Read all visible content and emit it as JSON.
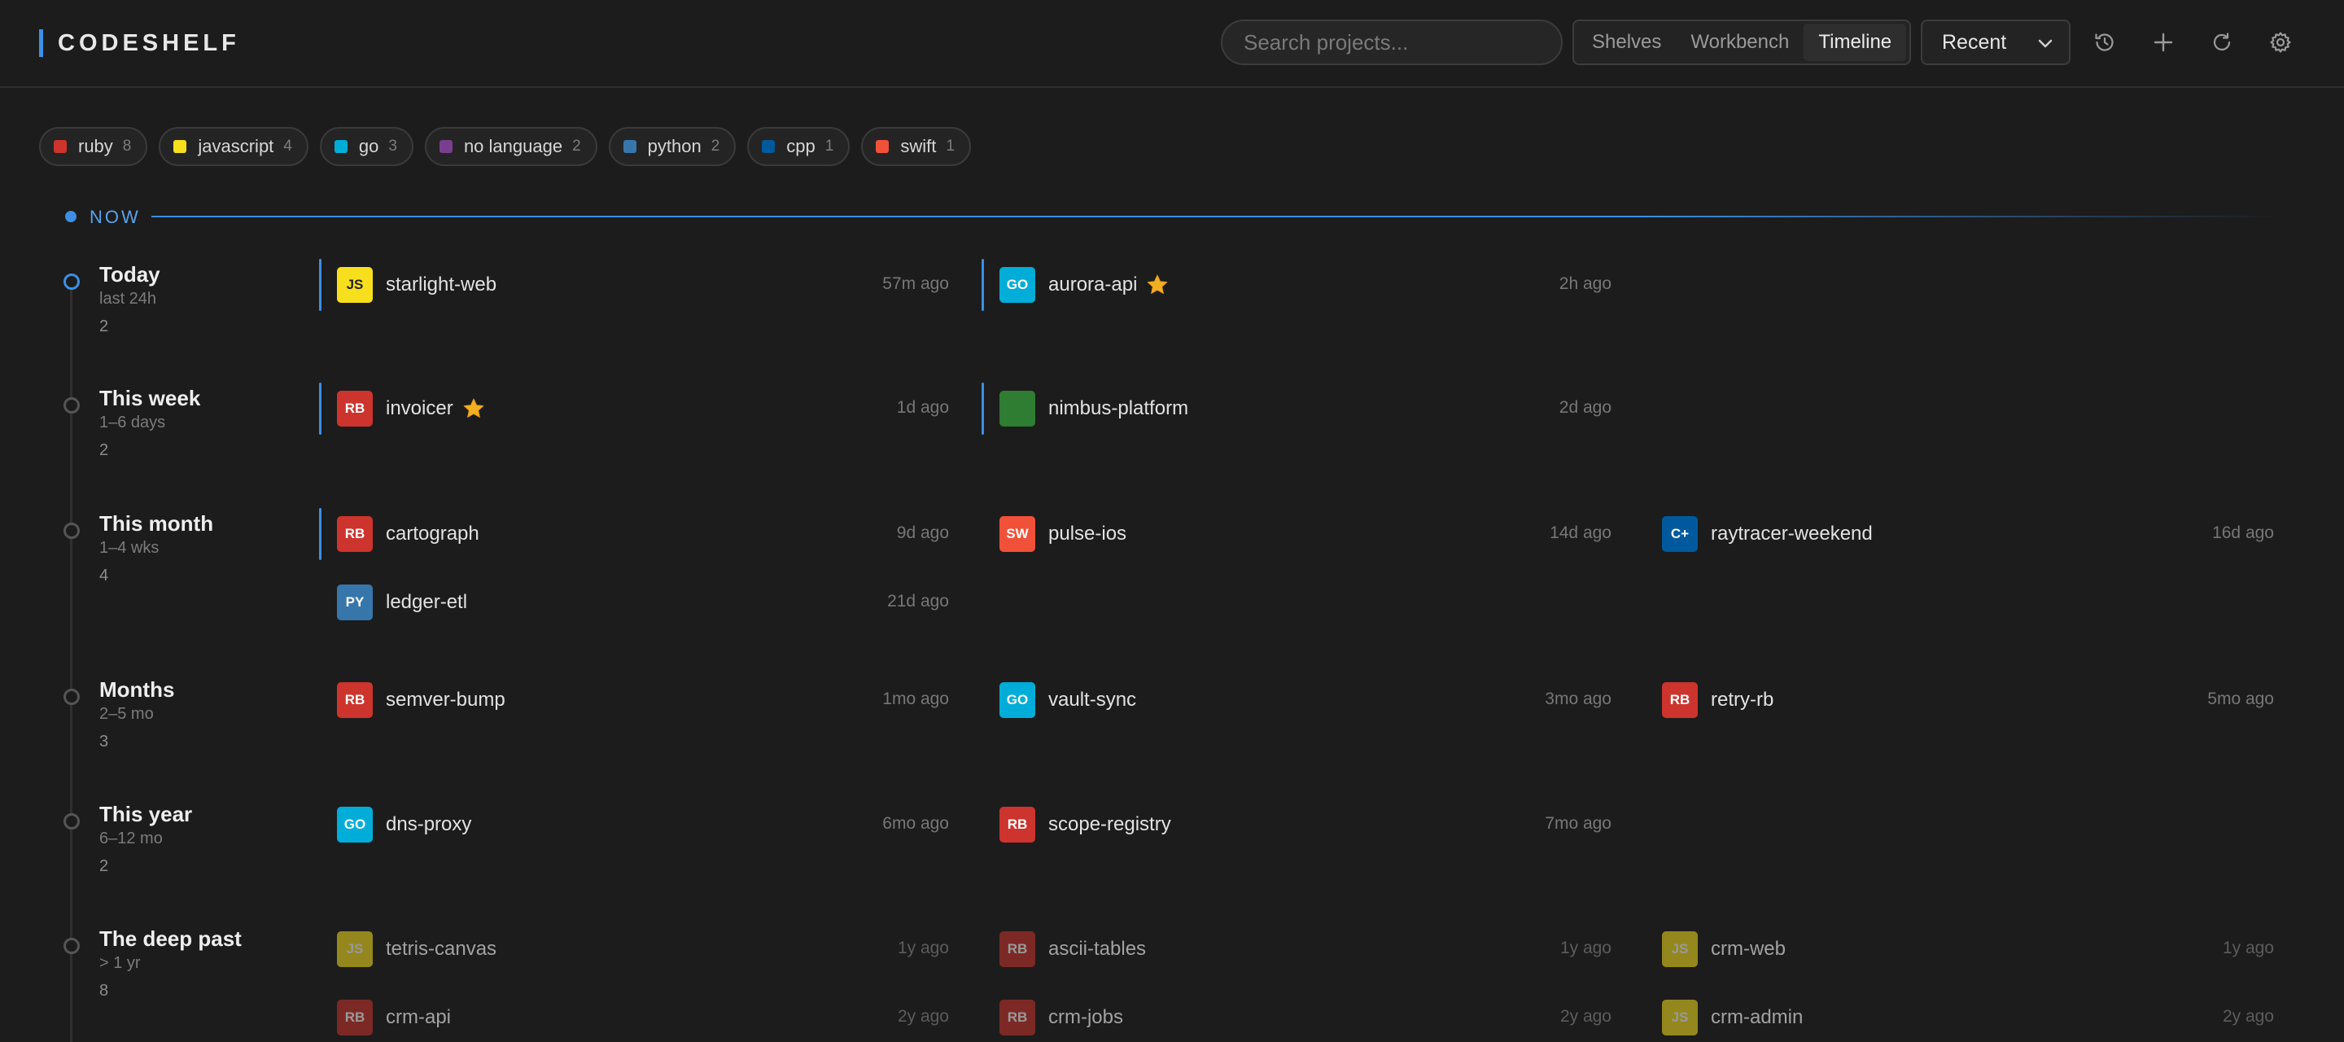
{
  "header": {
    "brand": "CODESHELF",
    "search_placeholder": "Search projects...",
    "views": [
      "Shelves",
      "Workbench",
      "Timeline"
    ],
    "active_view": "Timeline",
    "sort": "Recent",
    "icons": [
      "history-icon",
      "plus-icon",
      "refresh-icon",
      "gear-icon"
    ]
  },
  "languages": [
    {
      "name": "ruby",
      "count": "8",
      "color": "#cc342d"
    },
    {
      "name": "javascript",
      "count": "4",
      "color": "#f7df1e"
    },
    {
      "name": "go",
      "count": "3",
      "color": "#00add8"
    },
    {
      "name": "no language",
      "count": "2",
      "color": "#7a3e8f"
    },
    {
      "name": "python",
      "count": "2",
      "color": "#3776ab"
    },
    {
      "name": "cpp",
      "count": "1",
      "color": "#00599c"
    },
    {
      "name": "swift",
      "count": "1",
      "color": "#f05138"
    }
  ],
  "now_label": "NOW",
  "groups": [
    {
      "title": "Today",
      "range": "last 24h",
      "count": "2",
      "projects": [
        {
          "badge": "JS",
          "name": "starlight-web",
          "time": "57m ago",
          "color": "#f7df1e",
          "badge_text": "#222222"
        },
        {
          "badge": "GO",
          "name": "aurora-api",
          "time": "2h ago",
          "color": "#00add8",
          "starred": true
        }
      ]
    },
    {
      "title": "This week",
      "range": "1–6 days",
      "count": "2",
      "projects": [
        {
          "badge": "RB",
          "name": "invoicer",
          "time": "1d ago",
          "color": "#cc342d",
          "starred": true
        },
        {
          "badge": "",
          "name": "nimbus-platform",
          "time": "2d ago",
          "color": "#2e7d32"
        }
      ]
    },
    {
      "title": "This month",
      "range": "1–4 wks",
      "count": "4",
      "projects": [
        {
          "badge": "RB",
          "name": "cartograph",
          "time": "9d ago",
          "color": "#cc342d"
        },
        {
          "badge": "SW",
          "name": "pulse-ios",
          "time": "14d ago",
          "color": "#f05138"
        },
        {
          "badge": "C+",
          "name": "raytracer-weekend",
          "time": "16d ago",
          "color": "#00599c"
        },
        {
          "badge": "PY",
          "name": "ledger-etl",
          "time": "21d ago",
          "color": "#3776ab"
        }
      ]
    },
    {
      "title": "Months",
      "range": "2–5 mo",
      "count": "3",
      "projects": [
        {
          "badge": "RB",
          "name": "semver-bump",
          "time": "1mo ago",
          "color": "#cc342d"
        },
        {
          "badge": "GO",
          "name": "vault-sync",
          "time": "3mo ago",
          "color": "#00add8"
        },
        {
          "badge": "RB",
          "name": "retry-rb",
          "time": "5mo ago",
          "color": "#cc342d"
        }
      ]
    },
    {
      "title": "This year",
      "range": "6–12 mo",
      "count": "2",
      "projects": [
        {
          "badge": "GO",
          "name": "dns-proxy",
          "time": "6mo ago",
          "color": "#00add8"
        },
        {
          "badge": "RB",
          "name": "scope-registry",
          "time": "7mo ago",
          "color": "#cc342d"
        }
      ]
    },
    {
      "title": "The deep past",
      "range": "> 1 yr",
      "count": "8",
      "projects": [
        {
          "badge": "JS",
          "name": "tetris-canvas",
          "time": "1y ago",
          "color": "#f7df1e"
        },
        {
          "badge": "RB",
          "name": "ascii-tables",
          "time": "1y ago",
          "color": "#cc342d"
        },
        {
          "badge": "JS",
          "name": "crm-web",
          "time": "1y ago",
          "color": "#f7df1e"
        },
        {
          "badge": "RB",
          "name": "crm-api",
          "time": "2y ago",
          "color": "#cc342d"
        },
        {
          "badge": "RB",
          "name": "crm-jobs",
          "time": "2y ago",
          "color": "#cc342d"
        },
        {
          "badge": "JS",
          "name": "crm-admin",
          "time": "2y ago",
          "color": "#f7df1e"
        }
      ]
    }
  ]
}
